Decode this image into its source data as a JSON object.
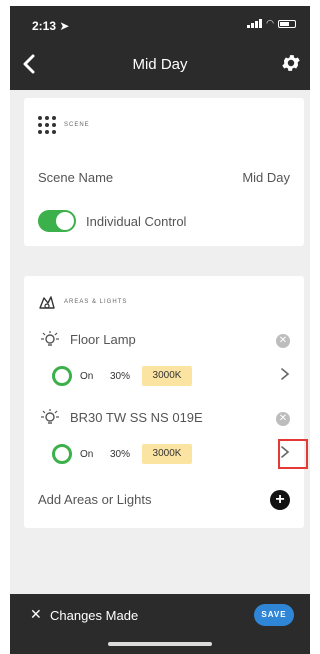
{
  "status_bar": {
    "time": "2:13"
  },
  "nav": {
    "title": "Mid Day"
  },
  "scene_card": {
    "section_label": "SCENE",
    "scene_name_label": "Scene Name",
    "scene_name_value": "Mid Day",
    "toggle_label": "Individual Control"
  },
  "areas_card": {
    "section_label": "AREAS & LIGHTS",
    "lights": [
      {
        "name": "Floor Lamp",
        "state": "On",
        "level": "30%",
        "cct": "3000K"
      },
      {
        "name": "BR30 TW SS NS 019E",
        "state": "On",
        "level": "30%",
        "cct": "3000K"
      }
    ],
    "add_label": "Add Areas or Lights"
  },
  "footer": {
    "changes_label": "Changes Made",
    "save_label": "SAVE"
  },
  "colors": {
    "header": "#2b2b2b",
    "accent_green": "#3cb04a",
    "save_blue": "#2f86d6",
    "cct_tag": "#fbe4a2",
    "highlight_red": "#e53935"
  }
}
